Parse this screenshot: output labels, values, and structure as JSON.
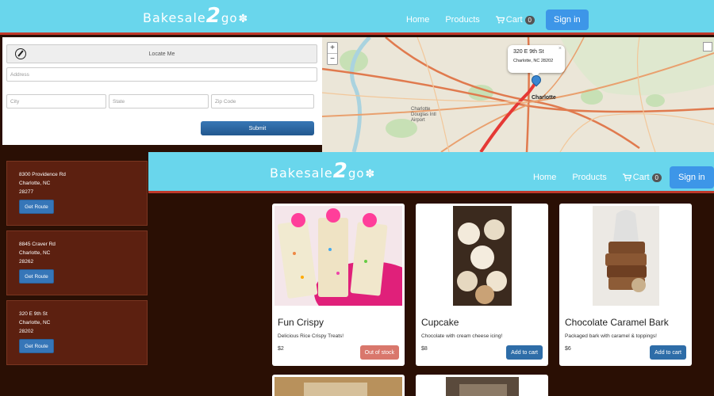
{
  "brand": {
    "text1": "Bakesale",
    "two": "2",
    "go": "go",
    "flake": "✽"
  },
  "nav": {
    "home": "Home",
    "products": "Products",
    "cart": "Cart",
    "cart_count": "0",
    "signin": "Sign in"
  },
  "locate_form": {
    "locate_label": "Locate Me",
    "address_placeholder": "Address",
    "city_placeholder": "City",
    "state_placeholder": "State",
    "zip_placeholder": "Zip Code",
    "submit_label": "Submit"
  },
  "map": {
    "zoom_in": "+",
    "zoom_out": "−",
    "popup_line1": "320 E 9th St",
    "popup_line2": "Charlotte, NC 28202",
    "popup_close": "×",
    "city_label": "Charlotte",
    "airport_label": "Charlotte Douglas Intl Airport",
    "colors": {
      "major_road": "#e07a4e",
      "route": "#e53935",
      "park": "#c7e0b5",
      "water": "#aad3df"
    }
  },
  "locations": [
    {
      "line1": "8300 Providence Rd",
      "line2": "Charlotte, NC",
      "line3": "28277",
      "button": "Get Route"
    },
    {
      "line1": "8845 Craver Rd",
      "line2": "Charlotte, NC",
      "line3": "28262",
      "button": "Get Route"
    },
    {
      "line1": "320 E 9th St",
      "line2": "Charlotte, NC",
      "line3": "28202",
      "button": "Get Route"
    }
  ],
  "products": [
    {
      "name": "Fun Crispy",
      "desc": "Delicious Rice Crispy Treats!",
      "price": "$2",
      "button": "Out of stock",
      "status": "out"
    },
    {
      "name": "Cupcake",
      "desc": "Chocolate with cream cheese icing!",
      "price": "$8",
      "button": "Add to cart",
      "status": "add"
    },
    {
      "name": "Chocolate Caramel Bark",
      "desc": "Packaged bark with caramel & toppings!",
      "price": "$6",
      "button": "Add to cart",
      "status": "add"
    }
  ],
  "colors": {
    "navbar": "#69d6ec",
    "accent_border": "#c0392b",
    "background": "#2a0f04",
    "location_card": "#5c2010",
    "primary_button": "#2e6da8",
    "out_of_stock": "#d9776c"
  }
}
